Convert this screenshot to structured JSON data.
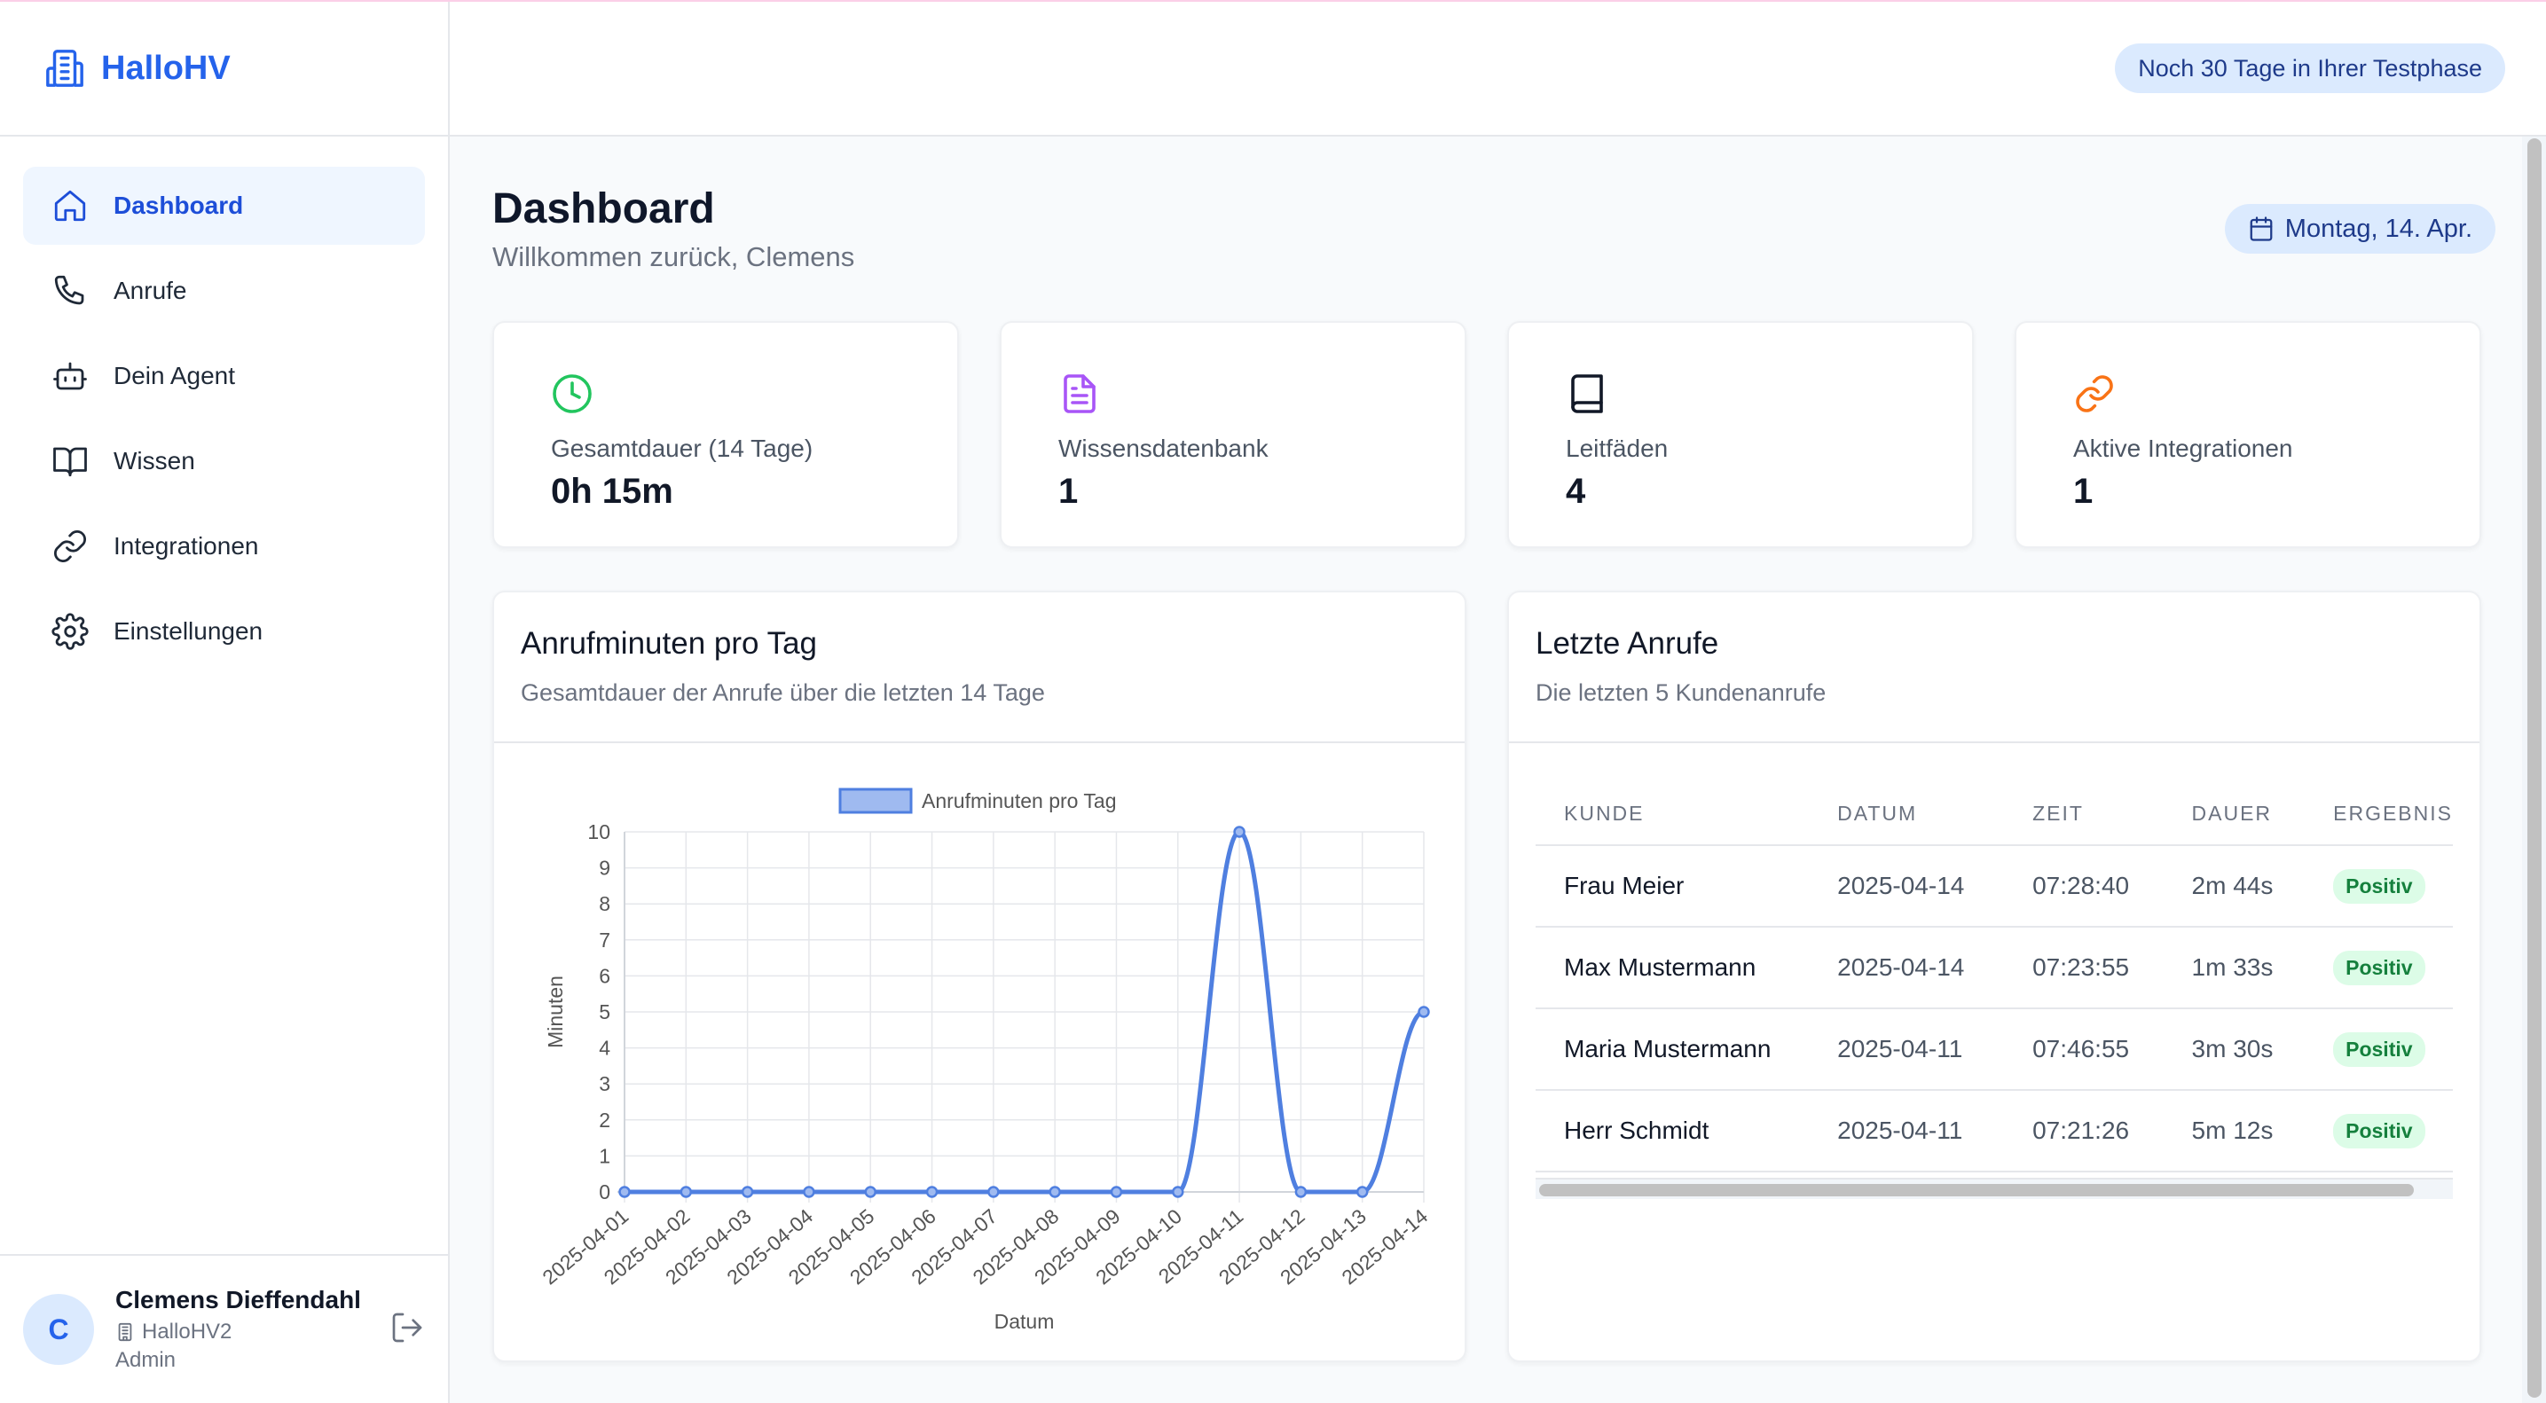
{
  "app": {
    "name": "HalloHV",
    "trial_badge": "Noch 30 Tage in Ihrer Testphase"
  },
  "sidebar": {
    "items": [
      {
        "label": "Dashboard",
        "icon": "home-icon",
        "active": true
      },
      {
        "label": "Anrufe",
        "icon": "phone-icon"
      },
      {
        "label": "Dein Agent",
        "icon": "bot-icon"
      },
      {
        "label": "Wissen",
        "icon": "book-open-icon"
      },
      {
        "label": "Integrationen",
        "icon": "link-icon"
      },
      {
        "label": "Einstellungen",
        "icon": "gear-icon"
      }
    ]
  },
  "user": {
    "initial": "C",
    "name": "Clemens Dieffendahl",
    "org": "HalloHV2",
    "role": "Admin"
  },
  "page": {
    "title": "Dashboard",
    "subtitle": "Willkommen zurück, Clemens",
    "date": "Montag, 14. Apr."
  },
  "stats": [
    {
      "label": "Gesamtdauer (14 Tage)",
      "value": "0h 15m",
      "icon": "clock-icon",
      "color": "#22c55e"
    },
    {
      "label": "Wissensdatenbank",
      "value": "1",
      "icon": "document-icon",
      "color": "#a855f7"
    },
    {
      "label": "Leitfäden",
      "value": "4",
      "icon": "book-icon",
      "color": "#111827"
    },
    {
      "label": "Aktive Integrationen",
      "value": "1",
      "icon": "link-icon",
      "color": "#f97316"
    }
  ],
  "chart_card": {
    "title": "Anrufminuten pro Tag",
    "subtitle": "Gesamtdauer der Anrufe über die letzten 14 Tage"
  },
  "chart_data": {
    "type": "line",
    "legend": "Anrufminuten pro Tag",
    "xlabel": "Datum",
    "ylabel": "Minuten",
    "ylim": [
      0,
      10
    ],
    "grid": true,
    "legend_position": "top",
    "color": "#4f7fe0",
    "x": [
      "2025-04-01",
      "2025-04-02",
      "2025-04-03",
      "2025-04-04",
      "2025-04-05",
      "2025-04-06",
      "2025-04-07",
      "2025-04-08",
      "2025-04-09",
      "2025-04-10",
      "2025-04-11",
      "2025-04-12",
      "2025-04-13",
      "2025-04-14"
    ],
    "values": [
      0,
      0,
      0,
      0,
      0,
      0,
      0,
      0,
      0,
      0,
      10,
      0,
      0,
      5
    ]
  },
  "calls_card": {
    "title": "Letzte Anrufe",
    "subtitle": "Die letzten 5 Kundenanrufe",
    "columns": [
      "KUNDE",
      "DATUM",
      "ZEIT",
      "DAUER",
      "ERGEBNIS"
    ],
    "rows": [
      {
        "kunde": "Frau Meier",
        "datum": "2025-04-14",
        "zeit": "07:28:40",
        "dauer": "2m 44s",
        "ergebnis": "Positiv"
      },
      {
        "kunde": "Max Mustermann",
        "datum": "2025-04-14",
        "zeit": "07:23:55",
        "dauer": "1m 33s",
        "ergebnis": "Positiv"
      },
      {
        "kunde": "Maria Mustermann",
        "datum": "2025-04-11",
        "zeit": "07:46:55",
        "dauer": "3m 30s",
        "ergebnis": "Positiv"
      },
      {
        "kunde": "Herr Schmidt",
        "datum": "2025-04-11",
        "zeit": "07:21:26",
        "dauer": "5m 12s",
        "ergebnis": "Positiv"
      }
    ]
  }
}
